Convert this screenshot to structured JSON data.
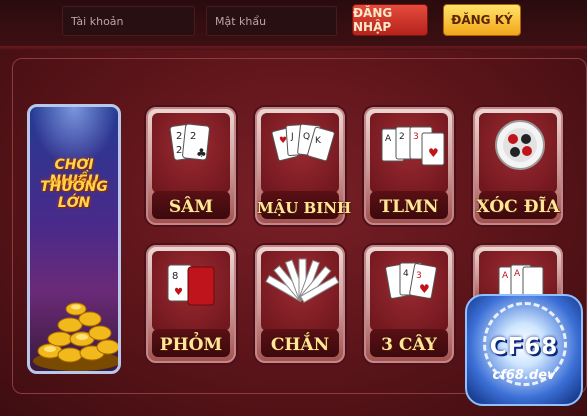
{
  "header": {
    "username_placeholder": "Tài khoản",
    "password_placeholder": "Mật khẩu",
    "login_label": "ĐĂNG NHẬP",
    "register_label": "ĐĂNG KÝ"
  },
  "banner": {
    "line1": "CHƠI NHIỀU",
    "line2": "THƯỞNG LỚN"
  },
  "games": [
    {
      "label": "SÂM"
    },
    {
      "label": "MẬU BINH"
    },
    {
      "label": "TLMN"
    },
    {
      "label": "XÓC ĐĨA"
    },
    {
      "label": "PHỎM"
    },
    {
      "label": "CHẮN"
    },
    {
      "label": "3 CÂY"
    }
  ],
  "logo": {
    "word": "CF68",
    "domain": "cf68.dev"
  },
  "colors": {
    "background": "#5a1419",
    "label_gold": "#ffe79a",
    "login_red": "#d23a2e",
    "register_yellow": "#f7c43a"
  }
}
